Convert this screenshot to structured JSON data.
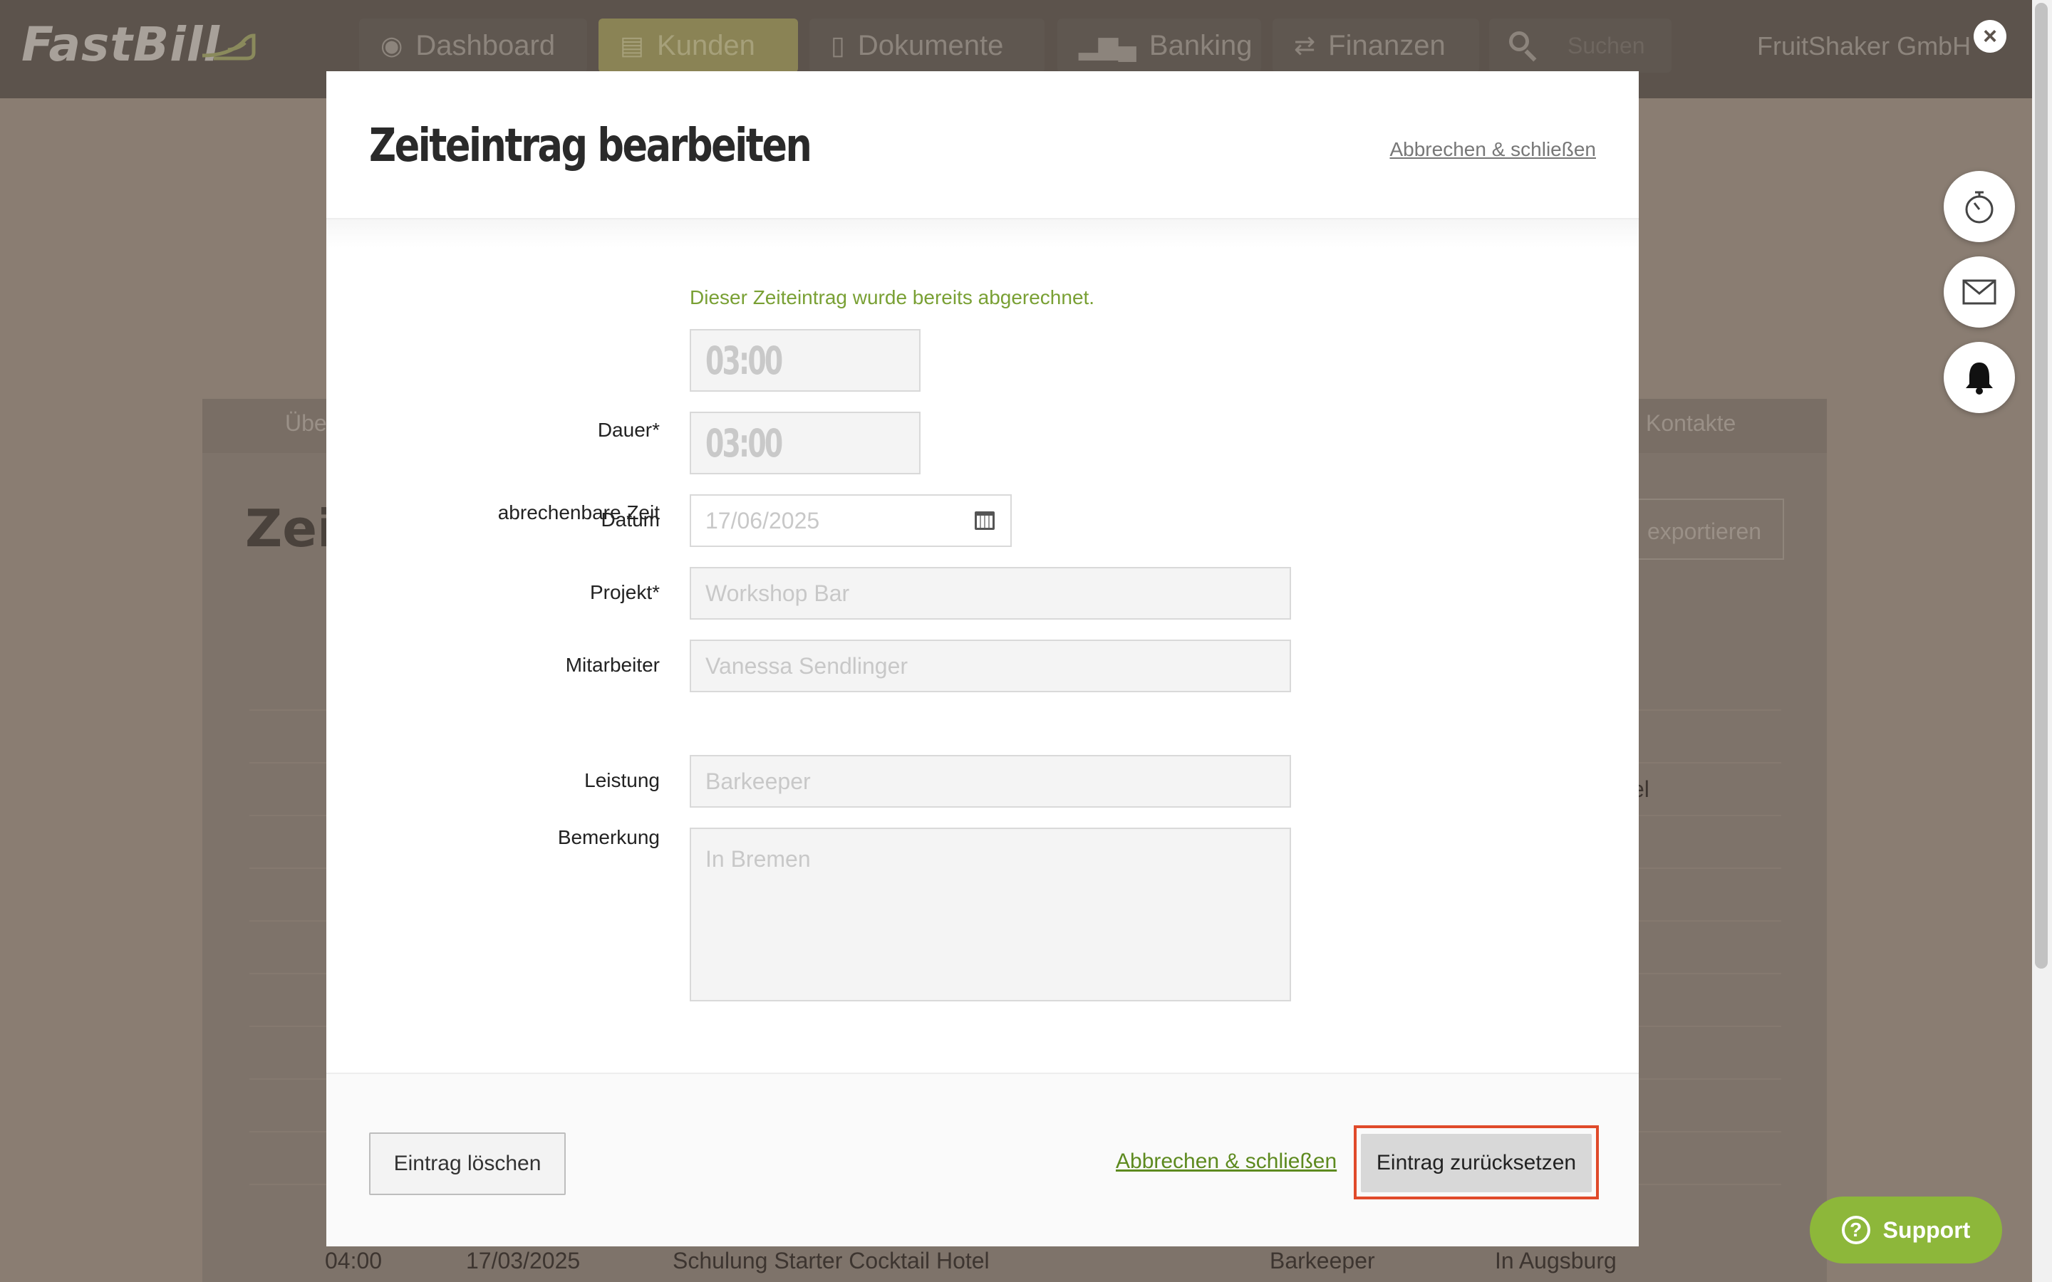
{
  "app": {
    "logo": "FastBill",
    "company": "FruitShaker GmbH"
  },
  "nav": [
    {
      "label": "Dashboard",
      "icon": "dashboard-icon"
    },
    {
      "label": "Kunden",
      "icon": "briefcase-icon"
    },
    {
      "label": "Dokumente",
      "icon": "document-icon"
    },
    {
      "label": "Banking",
      "icon": "bar-chart-icon"
    },
    {
      "label": "Finanzen",
      "icon": "arrows-icon"
    }
  ],
  "search": {
    "placeholder": "Suchen"
  },
  "background": {
    "tab_left": "Übe",
    "tab_right": "Kontakte",
    "heading": "Zeite",
    "export_label": "exportieren",
    "frag": "el",
    "row": {
      "duration": "04:00",
      "date": "17/03/2025",
      "project": "Schulung Starter Cocktail Hotel",
      "service": "Barkeeper",
      "note": "In Augsburg"
    }
  },
  "modal": {
    "title": "Zeiteintrag bearbeiten",
    "cancel_label": "Abbrechen & schließen",
    "notice": "Dieser Zeiteintrag wurde bereits abgerechnet.",
    "fields": {
      "dauer": {
        "label": "Dauer*",
        "value": "03:00"
      },
      "abrechenbar": {
        "label": "abrechenbare Zeit",
        "value": "03:00"
      },
      "datum": {
        "label": "Datum",
        "value": "17/06/2025"
      },
      "projekt": {
        "label": "Projekt*",
        "value": "Workshop Bar"
      },
      "mitarbeiter": {
        "label": "Mitarbeiter",
        "value": "Vanessa Sendlinger"
      },
      "leistung": {
        "label": "Leistung",
        "value": "Barkeeper"
      },
      "bemerkung": {
        "label": "Bemerkung",
        "value": "In Bremen"
      }
    },
    "footer": {
      "delete_label": "Eintrag löschen",
      "cancel_label": "Abbrechen & schließen",
      "reset_label": "Eintrag zurücksetzen"
    }
  },
  "support": {
    "label": "Support"
  },
  "side_buttons": [
    "stopwatch-icon",
    "mail-icon",
    "bell-icon"
  ],
  "colors": {
    "accent_green": "#8db73a",
    "notice_green": "#79a034",
    "focus_red": "#e04a2a"
  }
}
